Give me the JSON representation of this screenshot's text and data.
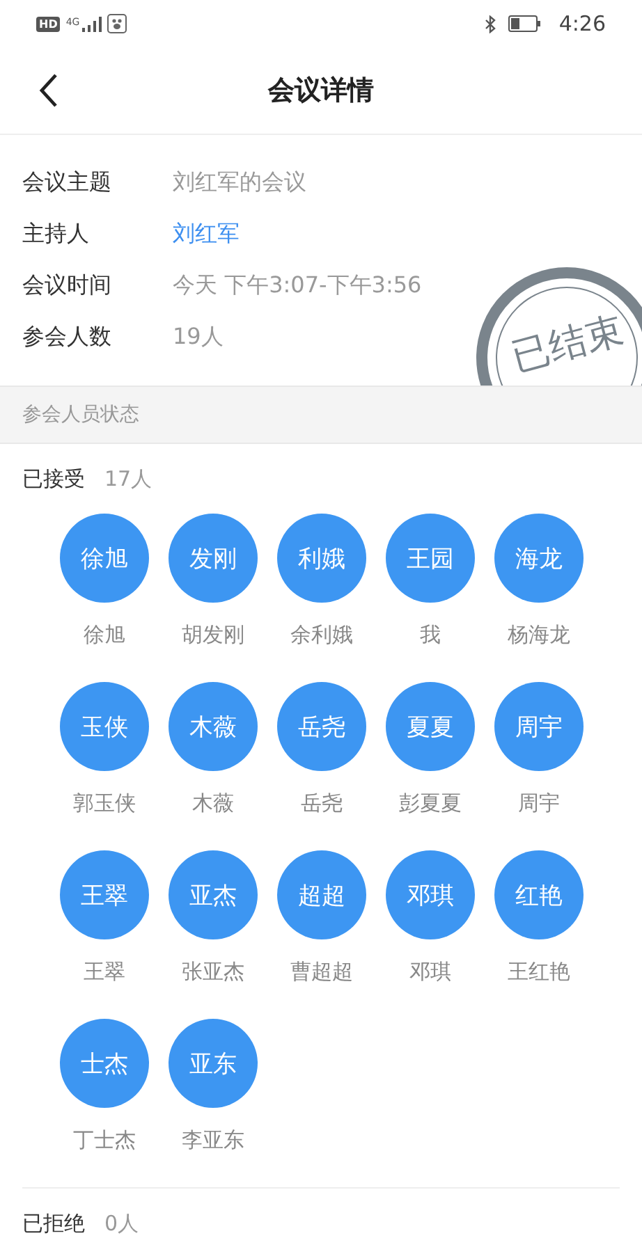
{
  "status_bar": {
    "hd_badge": "HD",
    "network": "4G",
    "time": "4:26"
  },
  "header": {
    "title": "会议详情"
  },
  "info": [
    {
      "label": "会议主题",
      "value": "刘红军的会议",
      "kind": "text"
    },
    {
      "label": "主持人",
      "value": "刘红军",
      "kind": "link"
    },
    {
      "label": "会议时间",
      "value": "今天 下午3:07-下午3:56",
      "kind": "text"
    },
    {
      "label": "参会人数",
      "value": "19人",
      "kind": "text"
    }
  ],
  "stamp": {
    "text": "已结束"
  },
  "section_title": "参会人员状态",
  "accepted": {
    "label": "已接受",
    "count": "17人",
    "people": [
      {
        "avatar": "徐旭",
        "name": "徐旭"
      },
      {
        "avatar": "发刚",
        "name": "胡发刚"
      },
      {
        "avatar": "利娥",
        "name": "余利娥"
      },
      {
        "avatar": "王园",
        "name": "我"
      },
      {
        "avatar": "海龙",
        "name": "杨海龙"
      },
      {
        "avatar": "玉侠",
        "name": "郭玉侠"
      },
      {
        "avatar": "木薇",
        "name": "木薇"
      },
      {
        "avatar": "岳尧",
        "name": "岳尧"
      },
      {
        "avatar": "夏夏",
        "name": "彭夏夏"
      },
      {
        "avatar": "周宇",
        "name": "周宇"
      },
      {
        "avatar": "王翠",
        "name": "王翠"
      },
      {
        "avatar": "亚杰",
        "name": "张亚杰"
      },
      {
        "avatar": "超超",
        "name": "曹超超"
      },
      {
        "avatar": "邓琪",
        "name": "邓琪"
      },
      {
        "avatar": "红艳",
        "name": "王红艳"
      },
      {
        "avatar": "士杰",
        "name": "丁士杰"
      },
      {
        "avatar": "亚东",
        "name": "李亚东"
      }
    ]
  },
  "rejected": {
    "label": "已拒绝",
    "count": "0人"
  }
}
